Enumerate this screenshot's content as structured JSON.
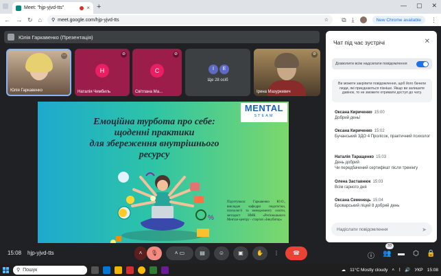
{
  "browser": {
    "tab_title": "Meet: \"hjp-yjvd-tts\"",
    "tab_close": "×",
    "new_tab": "+",
    "url": "meet.google.com/hjp-yjvd-tts",
    "new_chrome": "New Chrome available",
    "window_controls": [
      "—",
      "▢",
      "✕"
    ]
  },
  "presenter": {
    "label": "Юлія Гаркавенко (Презентація)"
  },
  "tiles": [
    {
      "name": "Юлія Гаркавенко"
    },
    {
      "name": "Наталія Чимбиль",
      "initial": "Н"
    },
    {
      "name": "Світлана Ма...",
      "initial": "С"
    },
    {
      "name": "Ще 28 осіб",
      "initials": [
        "I",
        "E"
      ]
    },
    {
      "name": "Ірина Мазуркевич"
    }
  ],
  "slide": {
    "title_lines": [
      "Емоційна турбота про себе:",
      "щоденні практики",
      "для збереження внутрішнього",
      "ресурсу"
    ],
    "logo_top": "MENTAL",
    "logo_bottom": "STEAM",
    "credit": "Підготувала: Гаркавенко Ю.О., викладач кафедри педагогіки, психології та менеджменту освіти, методист НМК «Регіонального Ментал-центру - стартап «Інкубатор»"
  },
  "chat": {
    "title": "Чат під час зустрічі",
    "close": "✕",
    "permission": "Дозволити всім надсилати повідомлення",
    "notice": "Ви можете закріпити повідомлення, щоб його бачили люди, які приєднаються пізніше. Якщо ви залишите дзвінок, то не зможете отримати доступ до чату.",
    "messages": [
      {
        "author": "Оксана Кириченко",
        "time": "15:00",
        "text": "Добрий день!"
      },
      {
        "author": "Оксана Кириченко",
        "time": "15:02",
        "text": "Бучанський ЗДО 4 Пролісок, практичний психолог"
      },
      {
        "author": "Наталія Таращенко",
        "time": "15:03",
        "text": "День добрий\nЧи передбачений сертифікат після тренінгу"
      },
      {
        "author": "Олена Заставнюк",
        "time": "15:03",
        "text": "Всім гарного дня"
      },
      {
        "author": "Оксана Семенець",
        "time": "15:04",
        "text": "Броварський ліцей 8 добрий день"
      }
    ],
    "input_placeholder": "Надіслати повідомлення"
  },
  "controls": {
    "time": "15:08",
    "meeting_code": "hjp-yjvd-tts",
    "participants_badge": "33"
  },
  "taskbar": {
    "search_placeholder": "Пошук",
    "weather": "11°C  Mostly cloudy",
    "lang": "УКР",
    "clock": "15:08"
  },
  "colors": {
    "accent": "#1a73e8",
    "end_call": "#ea4335",
    "tile_magenta": "#9c1d4a"
  }
}
